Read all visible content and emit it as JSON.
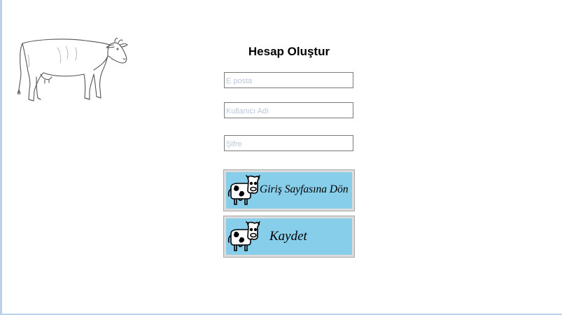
{
  "form": {
    "title": "Hesap Oluştur",
    "email_placeholder": "E posta",
    "username_placeholder": "Kullanıcı Adı",
    "password_placeholder": "Şifre",
    "back_button_label": "Giriş Sayfasına Dön",
    "save_button_label": "Kaydet"
  },
  "colors": {
    "button_background": "#87ceeb",
    "placeholder_text": "#b9c8dd",
    "window_border": "#b9d1ea"
  },
  "icons": {
    "decoration": "cow-sketch-icon",
    "button_icon": "cow-icon"
  }
}
